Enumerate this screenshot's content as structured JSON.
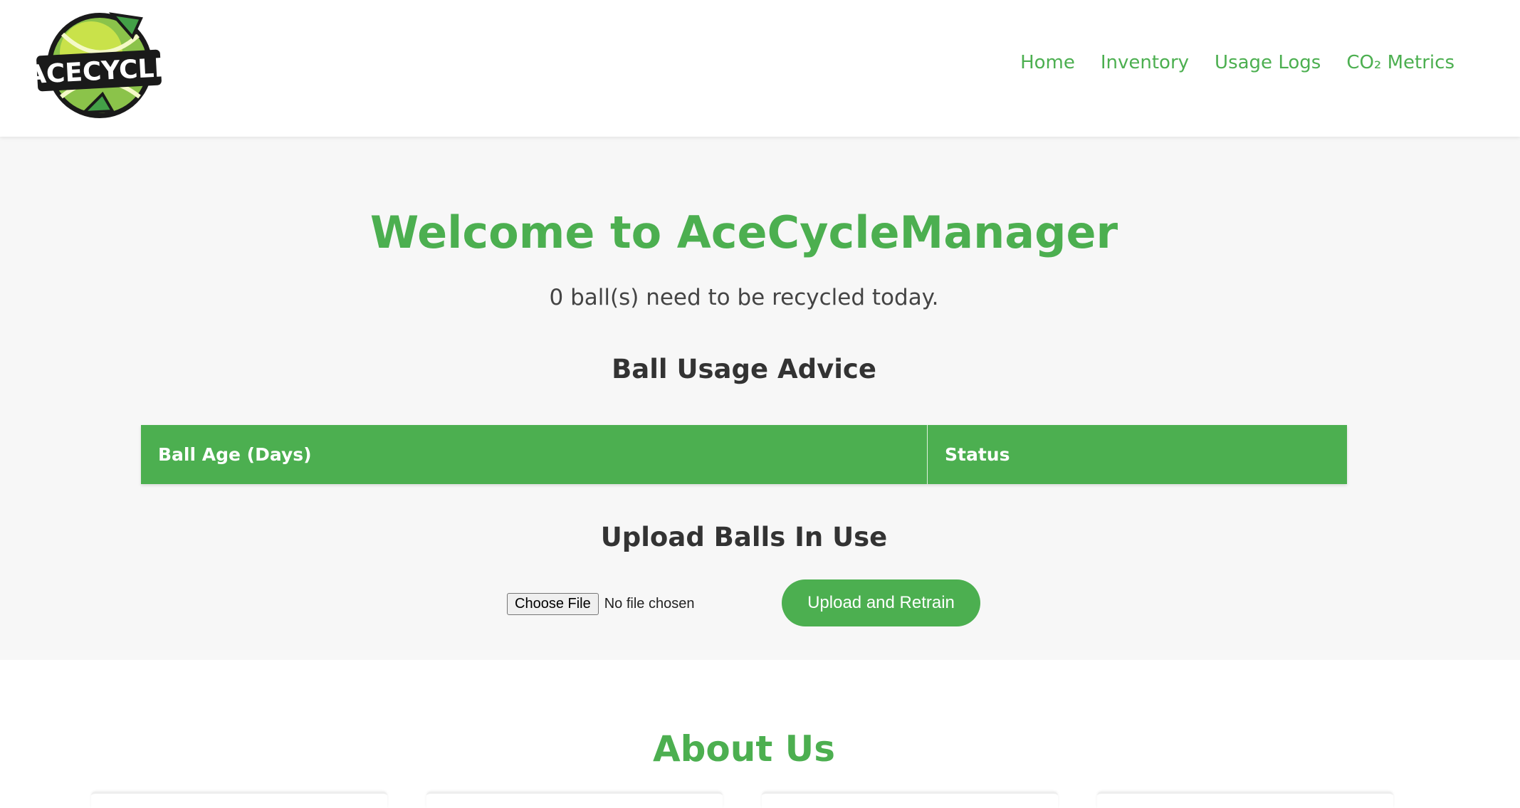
{
  "header": {
    "logo_text": "ACECYCLE",
    "nav": [
      {
        "label": "Home"
      },
      {
        "label": "Inventory"
      },
      {
        "label": "Usage Logs"
      },
      {
        "label": "CO₂ Metrics"
      }
    ]
  },
  "main": {
    "title": "Welcome to AceCycleManager",
    "recycle_message": "0 ball(s) need to be recycled today.",
    "advice": {
      "heading": "Ball Usage Advice",
      "columns": [
        "Ball Age (Days)",
        "Status"
      ]
    },
    "upload": {
      "heading": "Upload Balls In Use",
      "choose_file_label": "Choose File",
      "file_status": "No file chosen",
      "submit_label": "Upload and Retrain"
    }
  },
  "about": {
    "title": "About Us"
  },
  "colors": {
    "accent": "#4caf50",
    "main_bg": "#f7f7f7",
    "text": "#333333"
  }
}
